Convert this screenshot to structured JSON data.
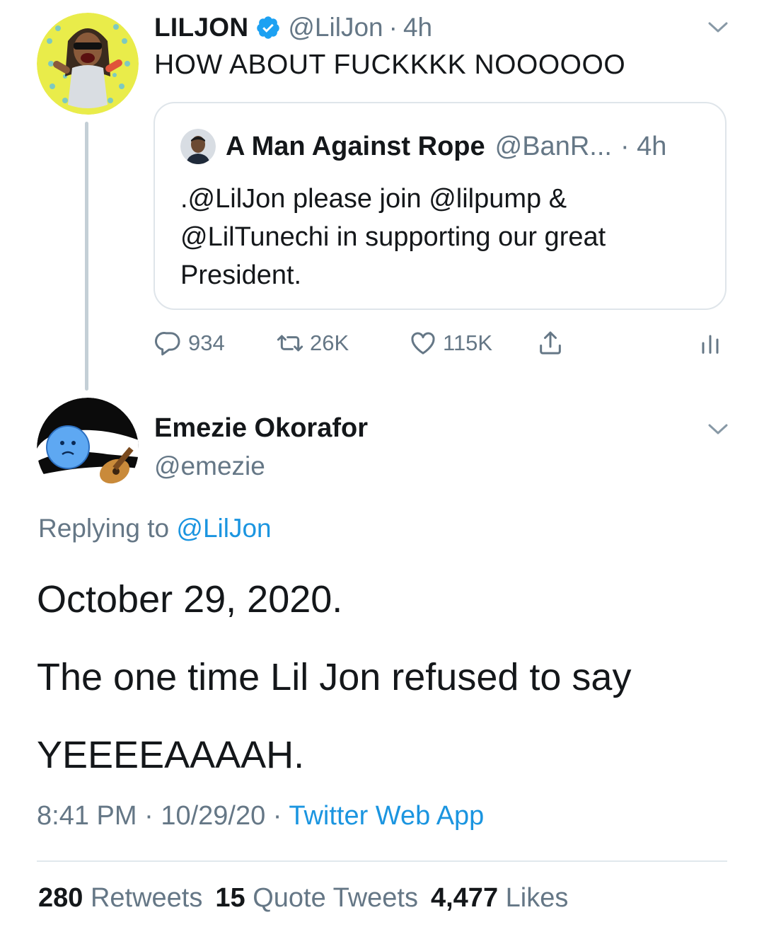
{
  "parent_tweet": {
    "display_name": "LILJON",
    "handle": "@LilJon",
    "separator": "·",
    "time": "4h",
    "text": "HOW ABOUT FUCKKKK NOOOOOO",
    "icons": {
      "verified": "verified-badge-icon",
      "more": "chevron-down-icon"
    }
  },
  "quoted_tweet": {
    "display_name": "A Man Against Rope",
    "handle": "@BanR...",
    "time": "· 4h",
    "text": ".@LilJon please join @lilpump & @LilTunechi in supporting our great President."
  },
  "actions": {
    "reply_count": "934",
    "retweet_count": "26K",
    "like_count": "115K",
    "icons": [
      "reply-icon",
      "retweet-icon",
      "like-icon",
      "share-icon",
      "analytics-icon"
    ]
  },
  "main_tweet": {
    "display_name": "Emezie Okorafor",
    "handle": "@emezie",
    "replying_prefix": "Replying to ",
    "replying_to": "@LilJon",
    "body_line_1": "October 29, 2020.",
    "body_line_2": "The one time Lil Jon refused to say",
    "body_line_3": "YEEEEAAAAH.",
    "time": "8:41 PM",
    "date": "10/29/20",
    "meta_separator": " · ",
    "source": "Twitter Web App"
  },
  "stats": {
    "retweets_count": "280",
    "retweets_label": " Retweets",
    "quotes_count": "15",
    "quotes_label": " Quote Tweets",
    "likes_count": "4,477",
    "likes_label": " Likes"
  },
  "colors": {
    "text": "#14171a",
    "secondary": "#657786",
    "link": "#1b95e0",
    "verified": "#1da1f2",
    "border": "#dfe5ea"
  }
}
